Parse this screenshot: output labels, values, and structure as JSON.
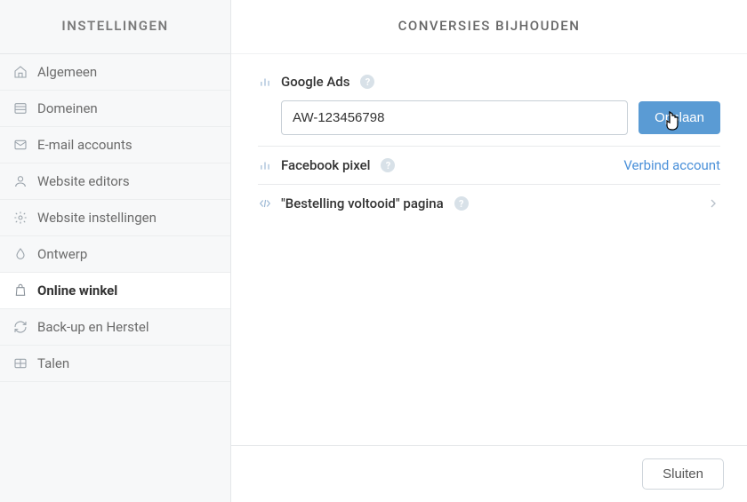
{
  "sidebar": {
    "title": "INSTELLINGEN",
    "items": [
      {
        "label": "Algemeen",
        "icon": "home"
      },
      {
        "label": "Domeinen",
        "icon": "list"
      },
      {
        "label": "E-mail accounts",
        "icon": "mail"
      },
      {
        "label": "Website editors",
        "icon": "user"
      },
      {
        "label": "Website instellingen",
        "icon": "gear"
      },
      {
        "label": "Ontwerp",
        "icon": "droplet"
      },
      {
        "label": "Online winkel",
        "icon": "bag",
        "active": true
      },
      {
        "label": "Back-up en Herstel",
        "icon": "refresh"
      },
      {
        "label": "Talen",
        "icon": "lang"
      }
    ]
  },
  "main": {
    "title": "CONVERSIES BIJHOUDEN",
    "google_ads": {
      "label": "Google Ads",
      "input_value": "AW-123456798",
      "save_label": "Opslaan"
    },
    "facebook_pixel": {
      "label": "Facebook pixel",
      "action_label": "Verbind account"
    },
    "order_completed": {
      "label": "\"Bestelling voltooid\" pagina"
    }
  },
  "footer": {
    "close_label": "Sluiten"
  }
}
